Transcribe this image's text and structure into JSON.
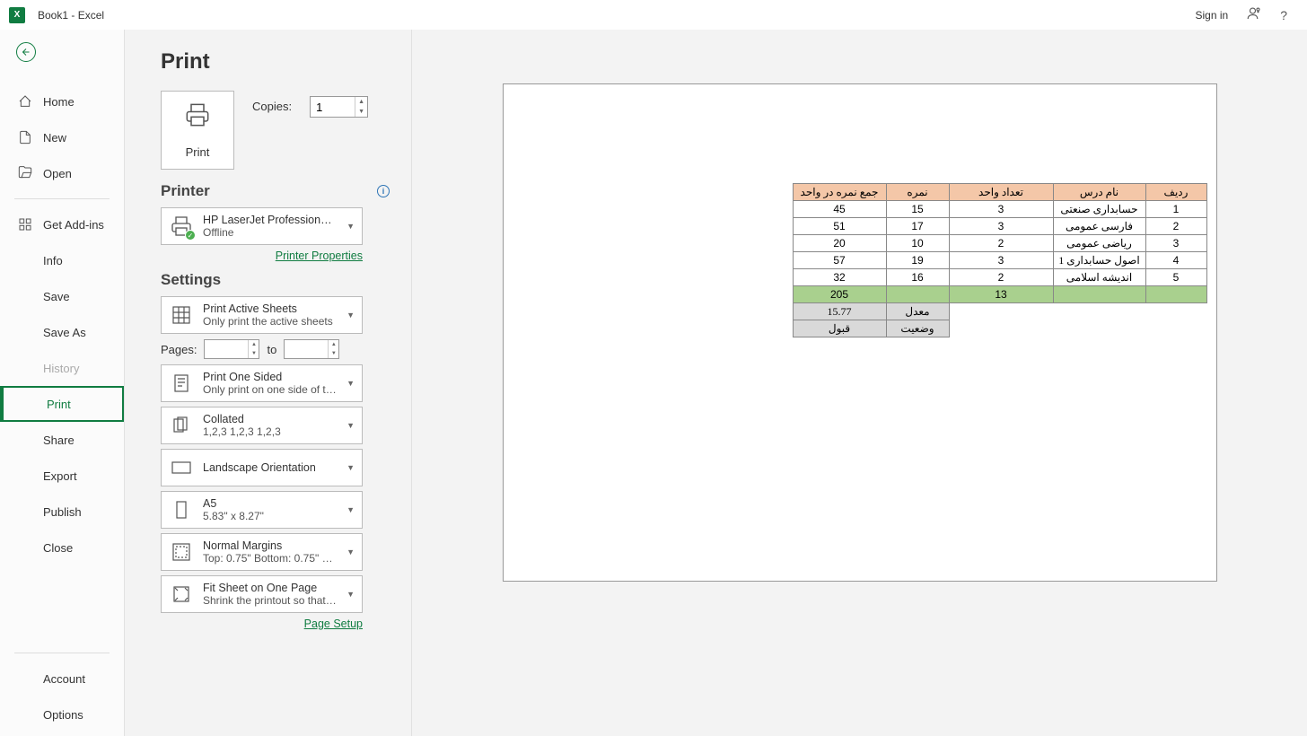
{
  "titlebar": {
    "app_icon_text": "X",
    "title": "Book1  -  Excel",
    "signin": "Sign in",
    "help": "?"
  },
  "sidebar": {
    "home": "Home",
    "new": "New",
    "open": "Open",
    "get_addins": "Get Add-ins",
    "info": "Info",
    "save": "Save",
    "save_as": "Save As",
    "history": "History",
    "print": "Print",
    "share": "Share",
    "export": "Export",
    "publish": "Publish",
    "close": "Close",
    "account": "Account",
    "options": "Options"
  },
  "print": {
    "title": "Print",
    "print_button": "Print",
    "copies_label": "Copies:",
    "copies_value": "1",
    "printer_header": "Printer",
    "printer_name": "HP LaserJet Professional M11...",
    "printer_status": "Offline",
    "printer_props": "Printer Properties",
    "settings_header": "Settings",
    "print_active_t": "Print Active Sheets",
    "print_active_s": "Only print the active sheets",
    "pages_label": "Pages:",
    "pages_to": "to",
    "sided_t": "Print One Sided",
    "sided_s": "Only print on one side of the...",
    "collated_t": "Collated",
    "collated_s": "1,2,3    1,2,3    1,2,3",
    "orientation": "Landscape Orientation",
    "paper_t": "A5",
    "paper_s": "5.83\" x 8.27\"",
    "margins_t": "Normal Margins",
    "margins_s": "Top: 0.75\" Bottom: 0.75\" Left:...",
    "fit_t": "Fit Sheet on One Page",
    "fit_s": "Shrink the printout so that it...",
    "page_setup": "Page Setup"
  },
  "preview": {
    "headers": {
      "sum": "جمع نمره در واحد",
      "score": "نمره",
      "units": "تعداد واحد",
      "name": "نام درس",
      "idx": "ردیف"
    },
    "rows": [
      {
        "sum": "45",
        "score": "15",
        "units": "3",
        "name": "حسابداری صنعتی",
        "idx": "1"
      },
      {
        "sum": "51",
        "score": "17",
        "units": "3",
        "name": "فارسی عمومی",
        "idx": "2"
      },
      {
        "sum": "20",
        "score": "10",
        "units": "2",
        "name": "ریاضی عمومی",
        "idx": "3"
      },
      {
        "sum": "57",
        "score": "19",
        "units": "3",
        "name": "اصول حسابداری 1",
        "idx": "4"
      },
      {
        "sum": "32",
        "score": "16",
        "units": "2",
        "name": "اندیشه اسلامی",
        "idx": "5"
      }
    ],
    "sum_row": {
      "sum": "205",
      "units": "13"
    },
    "avg_row": {
      "label": "معدل",
      "value": "15.77"
    },
    "status_row": {
      "label": "وضعیت",
      "value": "قبول"
    }
  }
}
